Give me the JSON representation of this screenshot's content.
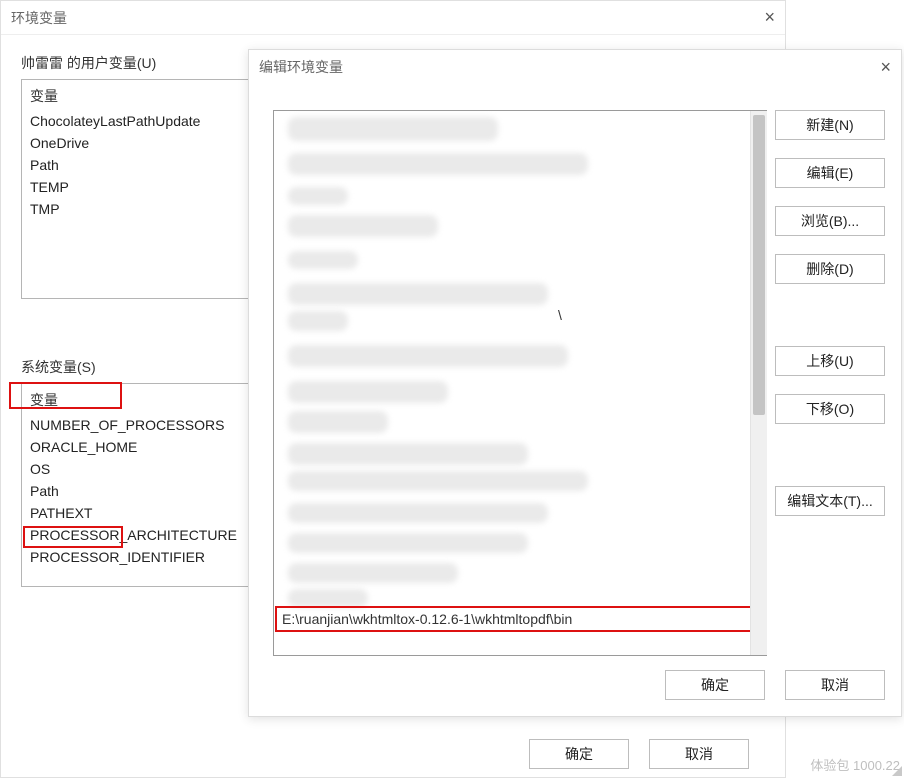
{
  "back_dialog": {
    "title": "环境变量",
    "user_section_label": "帅雷雷 的用户变量(U)",
    "user_header": "变量",
    "user_vars": [
      "ChocolateyLastPathUpdate",
      "OneDrive",
      "Path",
      "TEMP",
      "TMP"
    ],
    "system_section_label": "系统变量(S)",
    "system_header": "变量",
    "system_vars": [
      "NUMBER_OF_PROCESSORS",
      "ORACLE_HOME",
      "OS",
      "Path",
      "PATHEXT",
      "PROCESSOR_ARCHITECTURE",
      "PROCESSOR_IDENTIFIER"
    ],
    "ok": "确定",
    "cancel": "取消"
  },
  "front_dialog": {
    "title": "编辑环境变量",
    "path_value": "E:\\ruanjian\\wkhtmltox-0.12.6-1\\wkhtmltopdf\\bin",
    "partial_fragment": "\\",
    "buttons": {
      "new": "新建(N)",
      "edit": "编辑(E)",
      "browse": "浏览(B)...",
      "delete": "删除(D)",
      "moveup": "上移(U)",
      "movedown": "下移(O)",
      "edittext": "编辑文本(T)..."
    },
    "ok": "确定",
    "cancel": "取消"
  },
  "watermark": "体验包 1000.22"
}
